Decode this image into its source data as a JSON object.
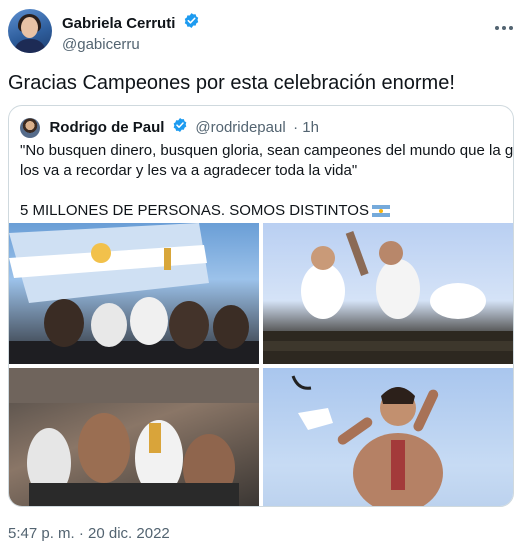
{
  "author": {
    "display_name": "Gabriela Cerruti",
    "handle": "@gabicerru",
    "verified": true,
    "avatar_icon": "profile-photo"
  },
  "tweet": {
    "text": "Gracias Campeones por esta celebración enorme!",
    "timestamp": "5:47 p. m. · 20 dic. 2022"
  },
  "quoted_tweet": {
    "display_name": "Rodrigo de Paul",
    "handle": "@rodridepaul",
    "age": "· 1h",
    "verified": true,
    "text_lines": [
      "\"No busquen dinero, busquen gloria, sean campeones del mundo que la gente",
      "los va a recordar y les va a agradecer toda la vida\"",
      "5 MILLONES DE PERSONAS. SOMOS DISTINTOS"
    ],
    "flag_icon": "argentina-flag"
  },
  "colors": {
    "verified": "#1d9bf0",
    "muted_text": "#536471",
    "border": "#cfd9de",
    "text": "#0f1419"
  }
}
